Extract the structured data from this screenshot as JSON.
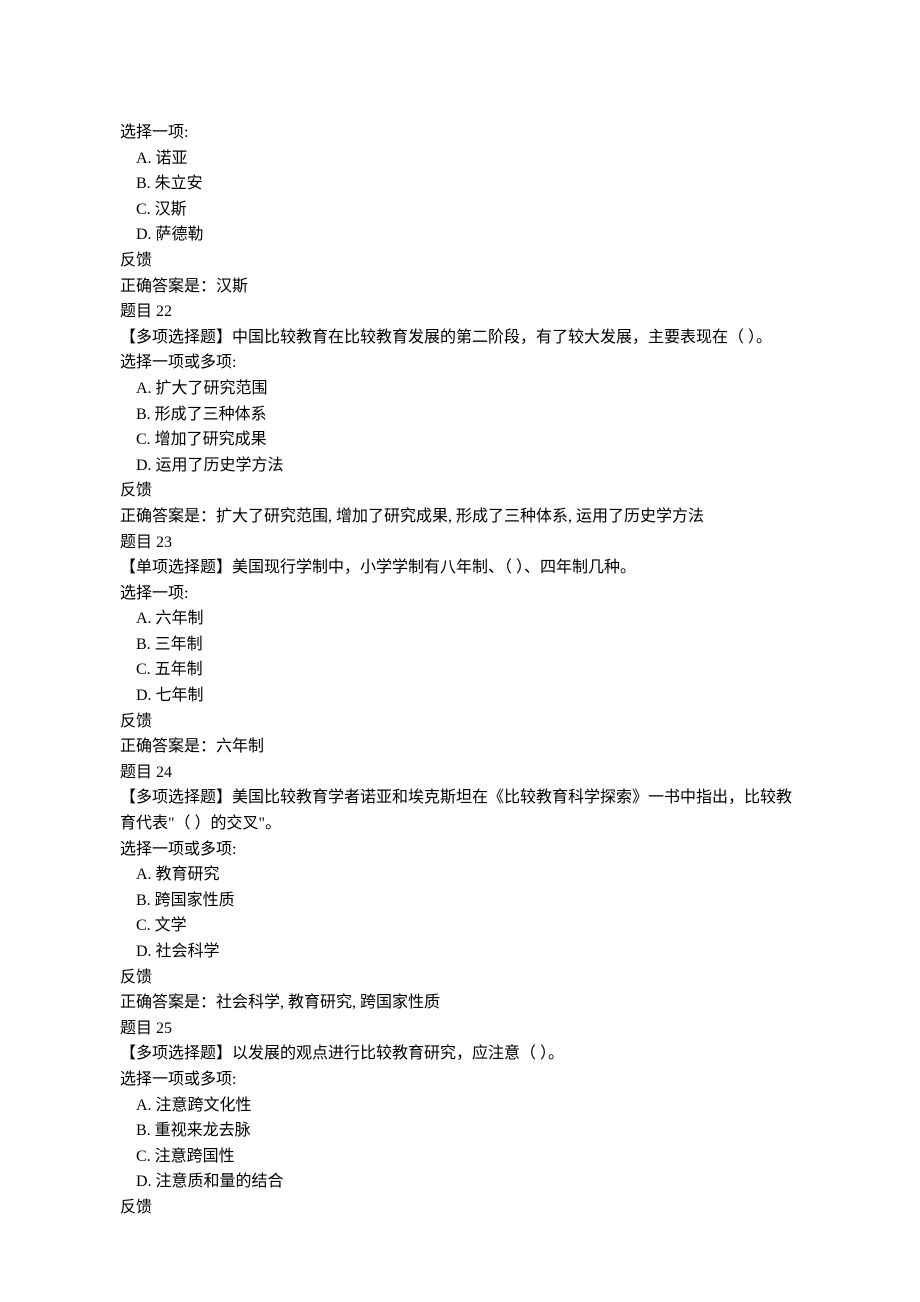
{
  "intro": {
    "select_one": "选择一项:"
  },
  "q21": {
    "options": [
      "A. 诺亚",
      "B. 朱立安",
      "C. 汉斯",
      "D. 萨德勒"
    ],
    "feedback": "反馈",
    "answer": "正确答案是：汉斯"
  },
  "q22": {
    "title": "题目 22",
    "prompt": "【多项选择题】中国比较教育在比较教育发展的第二阶段，有了较大发展，主要表现在（ ）。",
    "select": "选择一项或多项:",
    "options": [
      "A. 扩大了研究范围",
      "B. 形成了三种体系",
      "C. 增加了研究成果",
      "D. 运用了历史学方法"
    ],
    "feedback": "反馈",
    "answer": "正确答案是：扩大了研究范围, 增加了研究成果, 形成了三种体系, 运用了历史学方法"
  },
  "q23": {
    "title": "题目 23",
    "prompt": "【单项选择题】美国现行学制中，小学学制有八年制、（ ）、四年制几种。",
    "select": "选择一项:",
    "options": [
      "A. 六年制",
      "B. 三年制",
      "C. 五年制",
      "D. 七年制"
    ],
    "feedback": "反馈",
    "answer": "正确答案是：六年制"
  },
  "q24": {
    "title": "题目 24",
    "prompt": "【多项选择题】美国比较教育学者诺亚和埃克斯坦在《比较教育科学探索》一书中指出，比较教育代表\"（ ）的交叉\"。",
    "select": "选择一项或多项:",
    "options": [
      "A. 教育研究",
      "B. 跨国家性质",
      "C. 文学",
      "D. 社会科学"
    ],
    "feedback": "反馈",
    "answer": "正确答案是：社会科学, 教育研究, 跨国家性质"
  },
  "q25": {
    "title": "题目 25",
    "prompt": "【多项选择题】以发展的观点进行比较教育研究，应注意（ ）。",
    "select": "选择一项或多项:",
    "options": [
      "A. 注意跨文化性",
      "B. 重视来龙去脉",
      "C. 注意跨国性",
      "D. 注意质和量的结合"
    ],
    "feedback": "反馈"
  }
}
